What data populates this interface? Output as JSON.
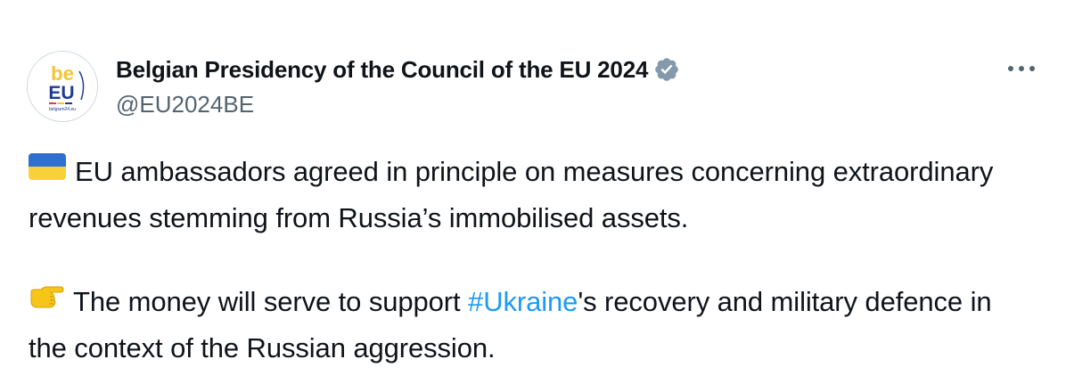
{
  "account": {
    "display_name": "Belgian Presidency of the Council of the EU 2024",
    "handle": "@EU2024BE",
    "verified": true,
    "avatar": {
      "line1": "be",
      "line2": "EU",
      "footer": "belgium24.eu"
    }
  },
  "tweet": {
    "paragraph1": {
      "emoji": "ukraine-flag-icon",
      "text": "EU ambassadors agreed in principle on measures concerning extraordinary revenues stemming from Russia’s immobilised assets."
    },
    "paragraph2": {
      "emoji": "pointing-hand-icon",
      "text_before": "The money will serve to support ",
      "hashtag": "#Ukraine",
      "text_after": "'s recovery and military defence in the context of the Russian aggression."
    }
  },
  "colors": {
    "text": "#0f1419",
    "secondary": "#536471",
    "link": "#1d9bf0",
    "verified_badge": "#829aab",
    "flag_blue": "#2f6fd0",
    "flag_yellow": "#f7d13a"
  }
}
